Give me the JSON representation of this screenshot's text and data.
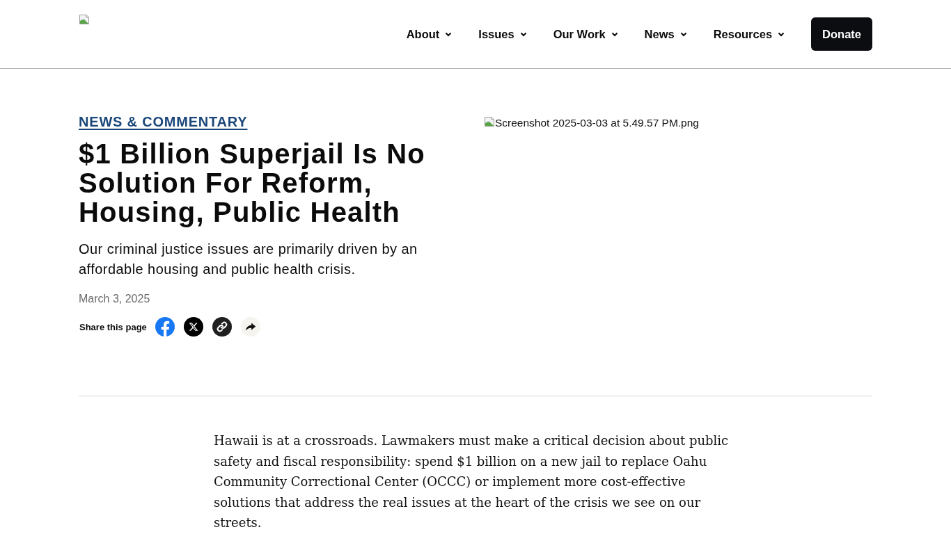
{
  "header": {
    "nav": [
      {
        "label": "About"
      },
      {
        "label": "Issues"
      },
      {
        "label": "Our Work"
      },
      {
        "label": "News"
      },
      {
        "label": "Resources"
      }
    ],
    "donate": "Donate"
  },
  "article": {
    "kicker": "NEWS & COMMENTARY",
    "title": "$1 Billion Superjail Is No Solution For Reform, Housing, Public Health",
    "subtitle": "Our criminal justice issues are primarily driven by an affordable housing and public health crisis.",
    "date": "March 3, 2025",
    "share": {
      "label": "Share this page",
      "buttons": [
        {
          "kind": "facebook"
        },
        {
          "kind": "x"
        },
        {
          "kind": "link"
        },
        {
          "kind": "share"
        }
      ]
    },
    "image": {
      "alt": "Screenshot 2025-03-03 at 5.49.57 PM.png"
    },
    "body": [
      "Hawaii is at a crossroads. Lawmakers must make a critical decision about public safety and fiscal responsibility: spend $1 billion on a new jail to replace Oahu Community Correctional Center (OCCC) or implement more cost-effective solutions that address the real issues at the heart of the crisis we see on our streets."
    ]
  }
}
